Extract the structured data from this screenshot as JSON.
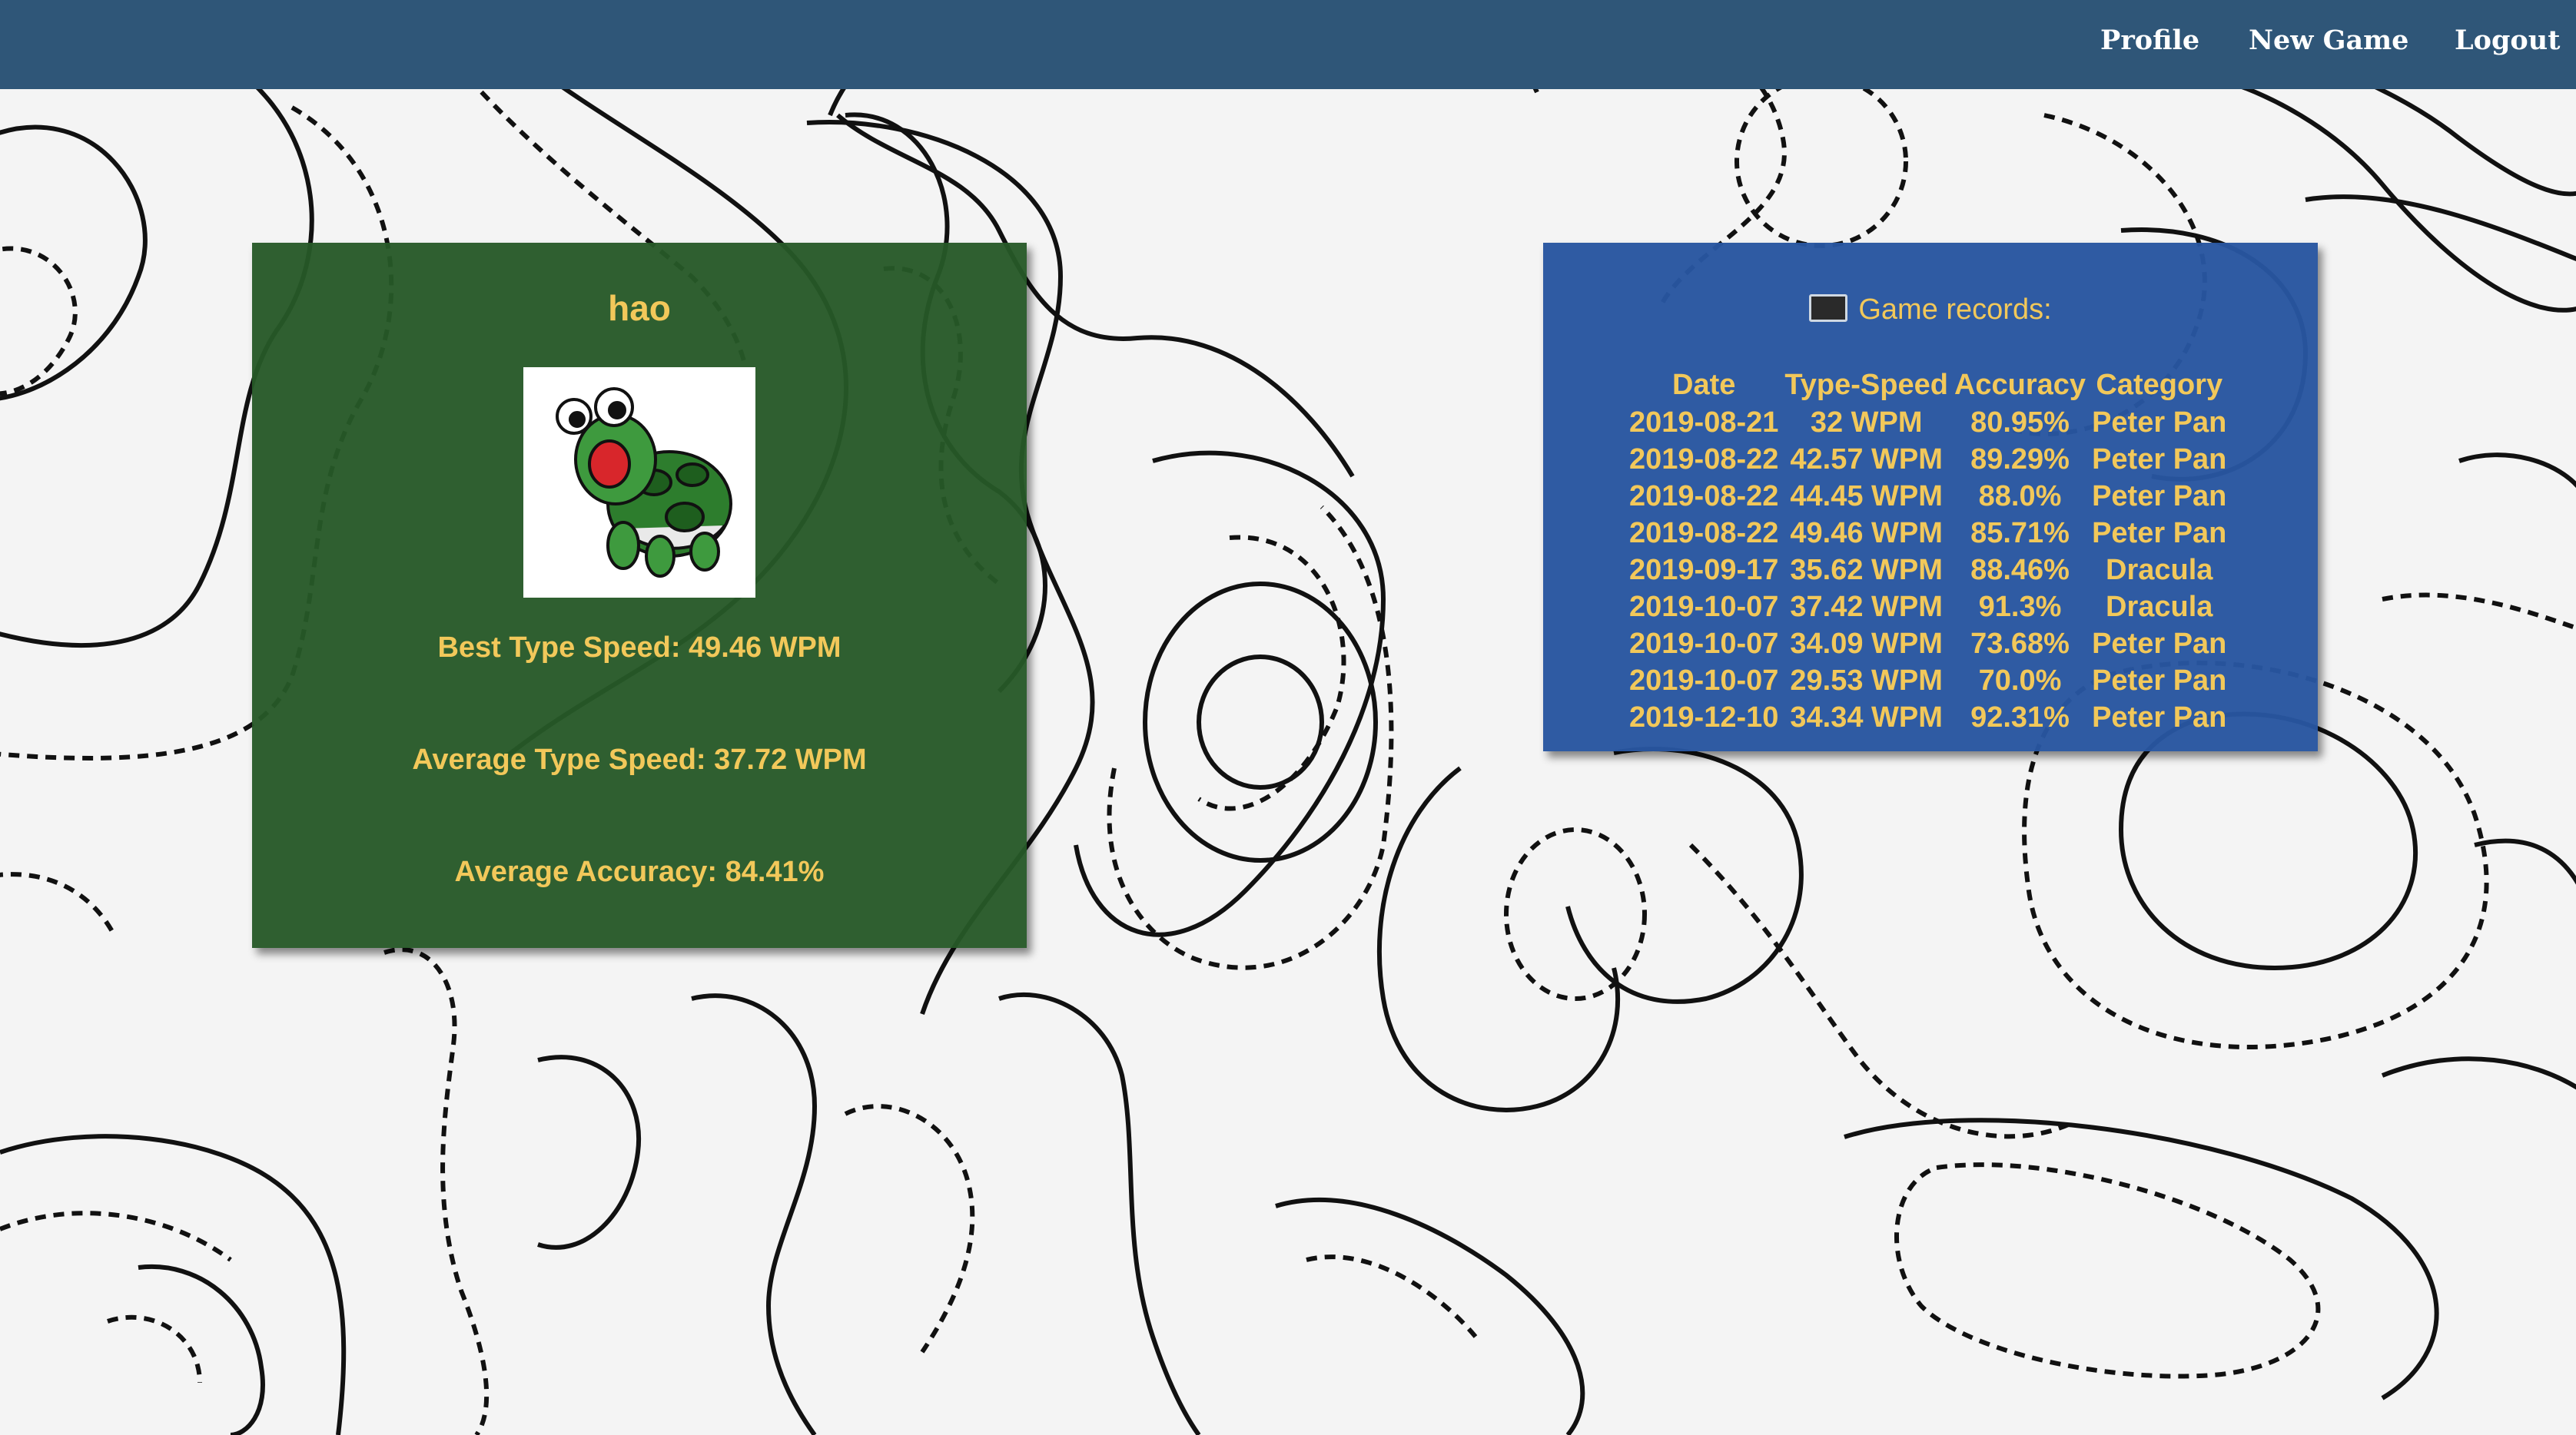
{
  "navbar": {
    "items": [
      "Profile",
      "New Game",
      "Logout"
    ]
  },
  "profile": {
    "username": "hao",
    "avatar_icon": "turtle-avatar",
    "best_speed": "Best Type Speed: 49.46 WPM",
    "avg_speed": "Average Type Speed: 37.72 WPM",
    "avg_accuracy": "Average Accuracy: 84.41%"
  },
  "records": {
    "title": "Game records:",
    "title_icon": "monitor-icon",
    "headers": [
      "Date",
      "Type-Speed",
      "Accuracy",
      "Category"
    ],
    "rows": [
      [
        "2019-08-21",
        "32 WPM",
        "80.95%",
        "Peter Pan"
      ],
      [
        "2019-08-22",
        "42.57 WPM",
        "89.29%",
        "Peter Pan"
      ],
      [
        "2019-08-22",
        "44.45 WPM",
        "88.0%",
        "Peter Pan"
      ],
      [
        "2019-08-22",
        "49.46 WPM",
        "85.71%",
        "Peter Pan"
      ],
      [
        "2019-09-17",
        "35.62 WPM",
        "88.46%",
        "Dracula"
      ],
      [
        "2019-10-07",
        "37.42 WPM",
        "91.3%",
        "Dracula"
      ],
      [
        "2019-10-07",
        "34.09 WPM",
        "73.68%",
        "Peter Pan"
      ],
      [
        "2019-10-07",
        "29.53 WPM",
        "70.0%",
        "Peter Pan"
      ],
      [
        "2019-12-10",
        "34.34 WPM",
        "92.31%",
        "Peter Pan"
      ]
    ]
  },
  "colors": {
    "navbar": "#2f5678",
    "profile_card": "#265828",
    "records_card": "#2856a0",
    "text_accent": "#f2c85a"
  }
}
